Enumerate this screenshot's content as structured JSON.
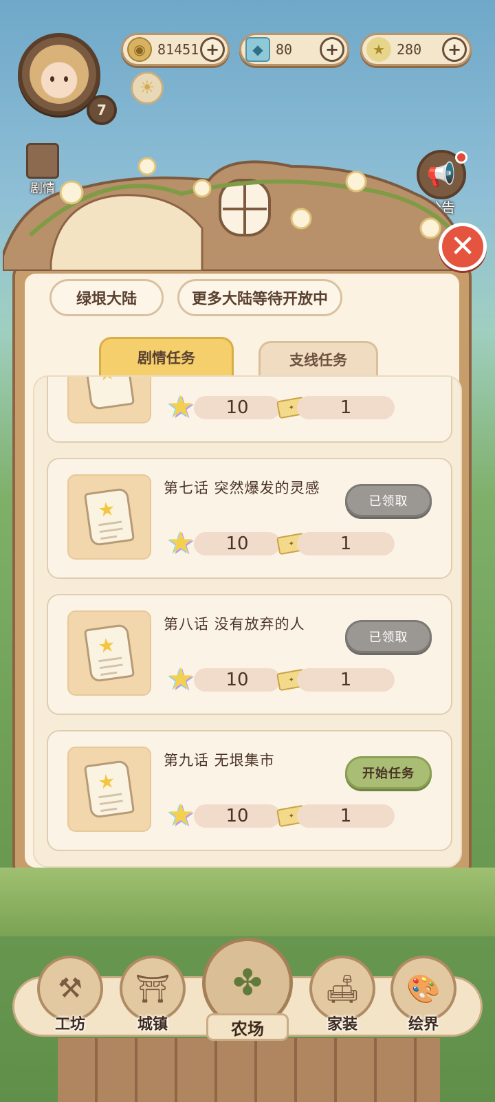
{
  "header": {
    "level": "7",
    "currencies": [
      {
        "icon": "coin-icon",
        "value": "81451"
      },
      {
        "icon": "gem-icon",
        "value": "80"
      },
      {
        "icon": "star-icon",
        "value": "280"
      }
    ]
  },
  "side": {
    "story_label": "剧情",
    "notice_label": "公告"
  },
  "regions": {
    "current": "绿垠大陆",
    "more": "更多大陆等待开放中"
  },
  "tabs": {
    "main": "剧情任务",
    "side": "支线任务"
  },
  "quests": [
    {
      "title": "",
      "star_reward": "10",
      "ticket_reward": "1",
      "action": ""
    },
    {
      "title": "第七话  突然爆发的灵感",
      "star_reward": "10",
      "ticket_reward": "1",
      "action": "已领取",
      "status": "claimed"
    },
    {
      "title": "第八话  没有放弃的人",
      "star_reward": "10",
      "ticket_reward": "1",
      "action": "已领取",
      "status": "claimed"
    },
    {
      "title": "第九话  无垠集市",
      "star_reward": "10",
      "ticket_reward": "1",
      "action": "开始任务",
      "status": "start"
    }
  ],
  "nav": {
    "workshop": "工坊",
    "town": "城镇",
    "farm": "农场",
    "home": "家装",
    "painting": "绘界"
  },
  "colors": {
    "accent_tab": "#f4cf6c",
    "claimed_button": "#9b9793",
    "start_button": "#a9bd74",
    "close_button": "#e4543f"
  }
}
